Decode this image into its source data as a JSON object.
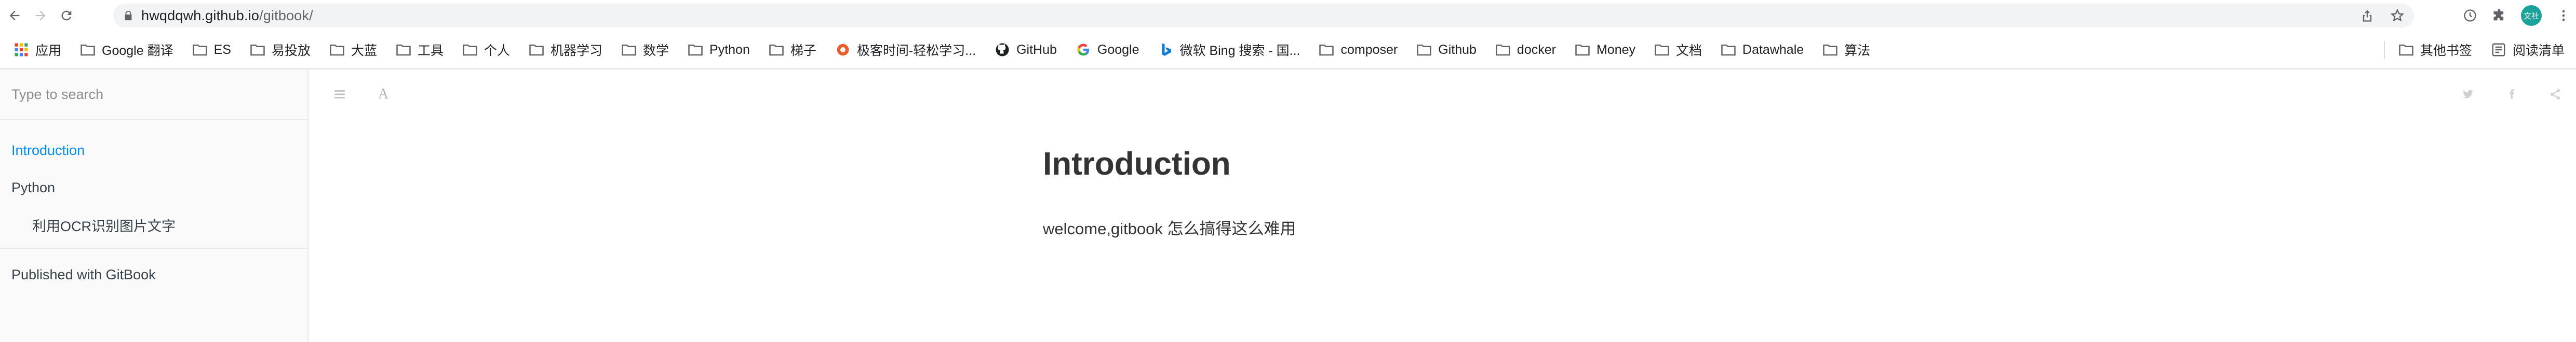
{
  "browser": {
    "url_host": "hwqdqwh.github.io",
    "url_path": "/gitbook/",
    "profile_initials": "文社"
  },
  "bookmarks": {
    "items": [
      {
        "label": "应用",
        "icon": "apps-grid-icon"
      },
      {
        "label": "Google 翻译",
        "icon": "folder-icon"
      },
      {
        "label": "ES",
        "icon": "folder-icon"
      },
      {
        "label": "易投放",
        "icon": "folder-icon"
      },
      {
        "label": "大蓝",
        "icon": "folder-icon"
      },
      {
        "label": "工具",
        "icon": "folder-icon"
      },
      {
        "label": "个人",
        "icon": "folder-icon"
      },
      {
        "label": "机器学习",
        "icon": "folder-icon"
      },
      {
        "label": "数学",
        "icon": "folder-icon"
      },
      {
        "label": "Python",
        "icon": "folder-icon"
      },
      {
        "label": "梯子",
        "icon": "folder-icon"
      },
      {
        "label": "极客时间-轻松学习...",
        "icon": "geektime-icon"
      },
      {
        "label": "GitHub",
        "icon": "github-icon"
      },
      {
        "label": "Google",
        "icon": "google-icon"
      },
      {
        "label": "微软 Bing 搜索 - 国...",
        "icon": "bing-icon"
      },
      {
        "label": "composer",
        "icon": "folder-icon"
      },
      {
        "label": "Github",
        "icon": "folder-icon"
      },
      {
        "label": "docker",
        "icon": "folder-icon"
      },
      {
        "label": "Money",
        "icon": "folder-icon"
      },
      {
        "label": "文档",
        "icon": "folder-icon"
      },
      {
        "label": "Datawhale",
        "icon": "folder-icon"
      },
      {
        "label": "算法",
        "icon": "folder-icon"
      }
    ],
    "other": "其他书签",
    "reading_list": "阅读清单"
  },
  "sidebar": {
    "search_placeholder": "Type to search",
    "items": [
      {
        "label": "Introduction",
        "active": true
      },
      {
        "label": "Python",
        "active": false
      },
      {
        "label": "利用OCR识别图片文字",
        "active": false
      }
    ],
    "published": "Published with GitBook"
  },
  "page": {
    "title": "Introduction",
    "body": "welcome,gitbook 怎么搞得这么难用"
  },
  "colors": {
    "accent": "#008cff",
    "sidebar_bg": "#fafafa",
    "profile_bg": "#1aa39a"
  }
}
